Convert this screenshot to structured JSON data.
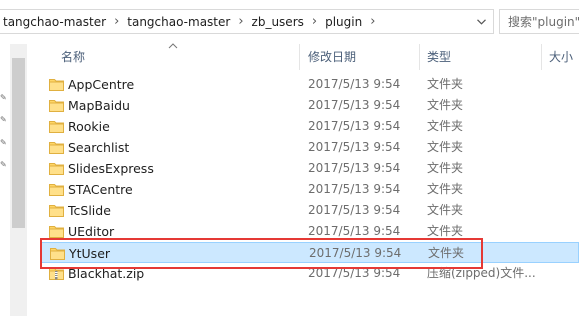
{
  "address_bar": {
    "crumbs": [
      "tangchao-master",
      "tangchao-master",
      "zb_users",
      "plugin"
    ],
    "separator": "›"
  },
  "search": {
    "placeholder": "搜索\"plugin\""
  },
  "columns": {
    "name": "名称",
    "date": "修改日期",
    "type": "类型",
    "size": "大小"
  },
  "files": [
    {
      "name": "AppCentre",
      "date": "2017/5/13 9:54",
      "type": "文件夹",
      "icon": "folder-icon"
    },
    {
      "name": "MapBaidu",
      "date": "2017/5/13 9:54",
      "type": "文件夹",
      "icon": "folder-icon"
    },
    {
      "name": "Rookie",
      "date": "2017/5/13 9:54",
      "type": "文件夹",
      "icon": "folder-icon"
    },
    {
      "name": "Searchlist",
      "date": "2017/5/13 9:54",
      "type": "文件夹",
      "icon": "folder-icon"
    },
    {
      "name": "SlidesExpress",
      "date": "2017/5/13 9:54",
      "type": "文件夹",
      "icon": "folder-icon"
    },
    {
      "name": "STACentre",
      "date": "2017/5/13 9:54",
      "type": "文件夹",
      "icon": "folder-icon"
    },
    {
      "name": "TcSlide",
      "date": "2017/5/13 9:54",
      "type": "文件夹",
      "icon": "folder-icon"
    },
    {
      "name": "UEditor",
      "date": "2017/5/13 9:54",
      "type": "文件夹",
      "icon": "folder-icon"
    },
    {
      "name": "YtUser",
      "date": "2017/5/13 9:54",
      "type": "文件夹",
      "icon": "folder-icon",
      "selected": true
    },
    {
      "name": "Blackhat.zip",
      "date": "2017/5/13 9:54",
      "type": "压缩(zipped)文件...",
      "icon": "zip-folder-icon"
    }
  ],
  "colors": {
    "selection_bg": "#cce8ff",
    "selection_border": "#99d1ff",
    "annotation": "#e53935",
    "folder": "#ffd666"
  }
}
